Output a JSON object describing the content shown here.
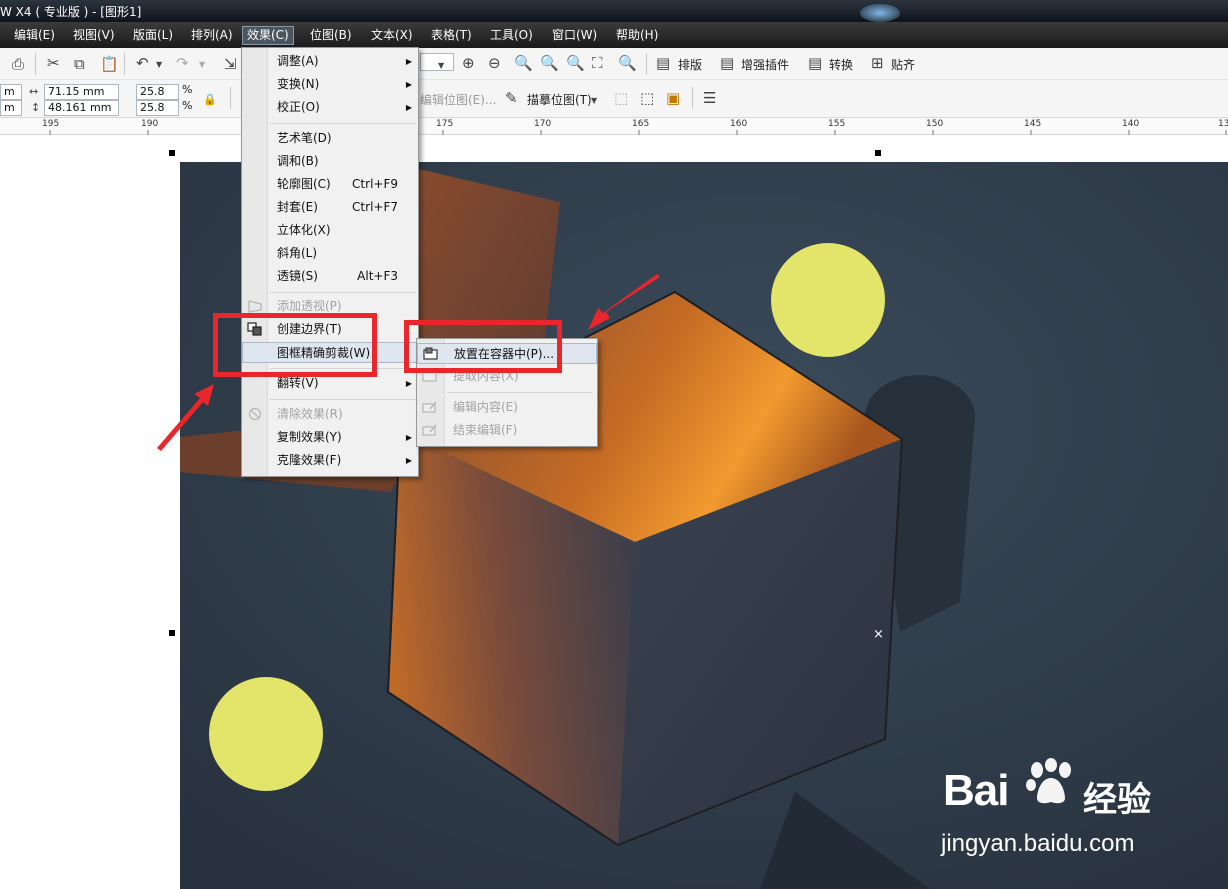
{
  "window": {
    "title": "W X4 ( 专业版 ) - [图形1]"
  },
  "menubar": {
    "items": [
      "编辑(E)",
      "视图(V)",
      "版面(L)",
      "排列(A)",
      "效果(C)",
      "位图(B)",
      "文本(X)",
      "表格(T)",
      "工具(O)",
      "窗口(W)",
      "帮助(H)"
    ],
    "active": "效果(C)"
  },
  "toolbar": {
    "width_value": "71.15 mm",
    "height_value": "48.161 mm",
    "scale_x": "25.8",
    "scale_y": "25.8",
    "percent": "%",
    "buttons": [
      "排版",
      "增强插件",
      "转换",
      "贴齐"
    ],
    "edit_bitmap": "编辑位图(E)...",
    "trace_bitmap": "描摹位图(T)"
  },
  "ruler": {
    "labels": [
      "195",
      "190",
      "175",
      "170",
      "165",
      "160",
      "155",
      "150",
      "145",
      "140",
      "13"
    ]
  },
  "effects_menu": {
    "items": [
      {
        "label": "调整(A)",
        "arrow": true
      },
      {
        "label": "变换(N)",
        "arrow": true
      },
      {
        "label": "校正(O)",
        "arrow": true
      },
      {
        "label": "艺术笔(D)"
      },
      {
        "label": "调和(B)"
      },
      {
        "label": "轮廓图(C)",
        "shortcut": "Ctrl+F9"
      },
      {
        "label": "封套(E)",
        "shortcut": "Ctrl+F7"
      },
      {
        "label": "立体化(X)"
      },
      {
        "label": "斜角(L)"
      },
      {
        "label": "透镜(S)",
        "shortcut": "Alt+F3"
      },
      {
        "label": "添加透视(P)",
        "disabled": true
      },
      {
        "label": "创建边界(T)"
      },
      {
        "label": "图框精确剪裁(W)",
        "arrow": true,
        "highlighted": true
      },
      {
        "label": "翻转(V)",
        "arrow": true
      },
      {
        "label": "清除效果(R)",
        "disabled": true
      },
      {
        "label": "复制效果(Y)",
        "arrow": true
      },
      {
        "label": "克隆效果(F)",
        "arrow": true
      }
    ]
  },
  "powerclip_submenu": {
    "items": [
      {
        "label": "放置在容器中(P)...",
        "disabled": false
      },
      {
        "label": "提取内容(X)",
        "disabled": true
      },
      {
        "label": "编辑内容(E)",
        "disabled": true
      },
      {
        "label": "结束编辑(F)",
        "disabled": true
      }
    ]
  },
  "watermark": {
    "brand": "Bai",
    "brand_cn": "经验",
    "url": "jingyan.baidu.com"
  },
  "colors": {
    "menu_bg": "#f1f1f1",
    "highlight": "#dfe6ef",
    "annotation_red": "#e8262b",
    "artwork_bg": "#2f3d4c",
    "circle_yellow": "#e3e46a",
    "cube_orange": "#e87c22"
  }
}
